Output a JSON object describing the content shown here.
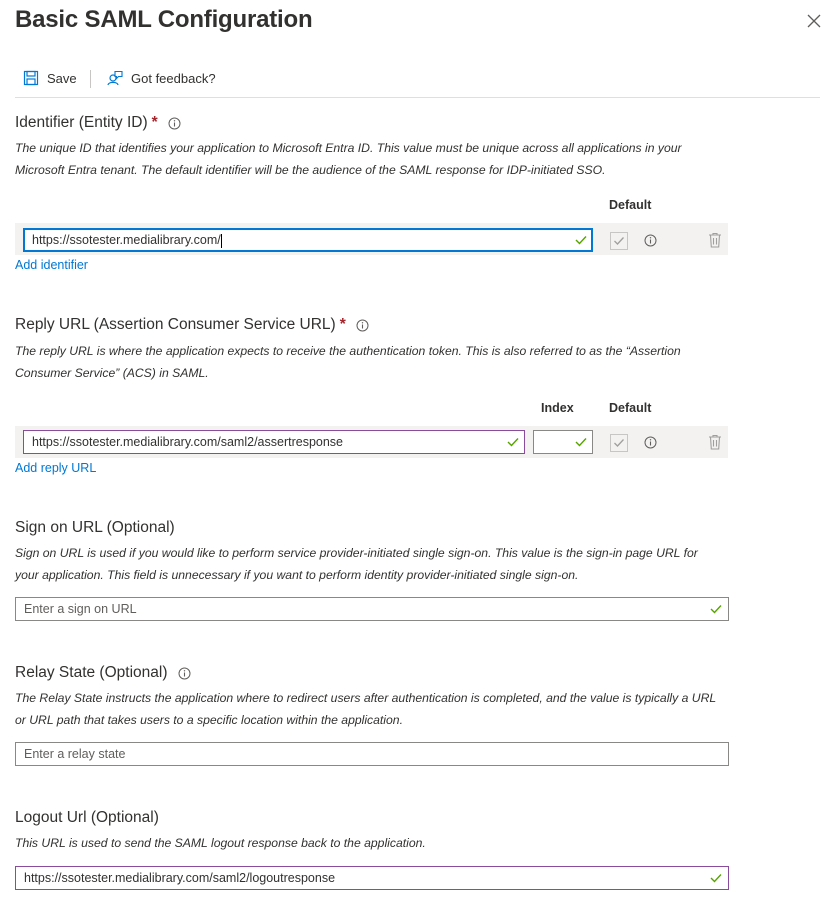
{
  "title": "Basic SAML Configuration",
  "toolbar": {
    "save_label": "Save",
    "feedback_label": "Got feedback?"
  },
  "identifier": {
    "label": "Identifier (Entity ID)",
    "required_mark": "*",
    "description": "The unique ID that identifies your application to Microsoft Entra ID. This value must be unique across all applications in your Microsoft Entra tenant. The default identifier will be the audience of the SAML response for IDP-initiated SSO.",
    "default_header": "Default",
    "value": "https://ssotester.medialibrary.com/",
    "add_link": "Add identifier"
  },
  "reply": {
    "label": "Reply URL (Assertion Consumer Service URL)",
    "required_mark": "*",
    "description": "The reply URL is where the application expects to receive the authentication token. This is also referred to as the “Assertion Consumer Service” (ACS) in SAML.",
    "index_header": "Index",
    "default_header": "Default",
    "value": "https://ssotester.medialibrary.com/saml2/assertresponse",
    "index_value": "",
    "add_link": "Add reply URL"
  },
  "signon": {
    "label": "Sign on URL (Optional)",
    "description": "Sign on URL is used if you would like to perform service provider-initiated single sign-on. This value is the sign-in page URL for your application. This field is unnecessary if you want to perform identity provider-initiated single sign-on.",
    "placeholder": "Enter a sign on URL"
  },
  "relay": {
    "label": "Relay State (Optional)",
    "description": "The Relay State instructs the application where to redirect users after authentication is completed, and the value is typically a URL or URL path that takes users to a specific location within the application.",
    "placeholder": "Enter a relay state"
  },
  "logout": {
    "label": "Logout Url (Optional)",
    "description": "This URL is used to send the SAML logout response back to the application.",
    "value": "https://ssotester.medialibrary.com/saml2/logoutresponse"
  },
  "colors": {
    "accent": "#0078d4",
    "valid_check": "#57a300",
    "required": "#a4262c",
    "input_border_purple": "#8a4b9c"
  }
}
